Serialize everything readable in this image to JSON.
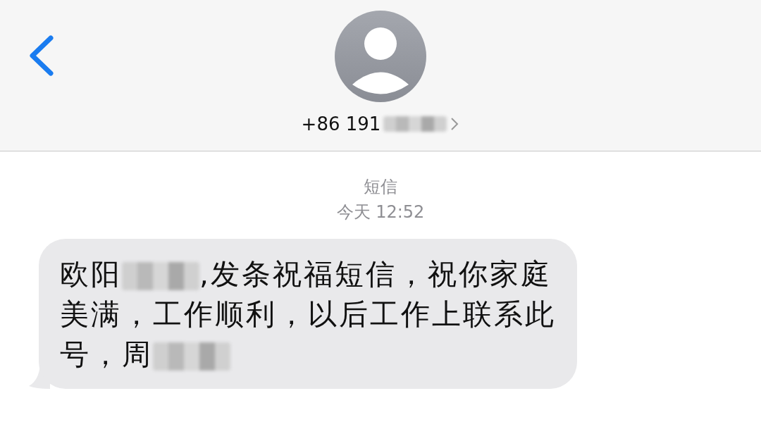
{
  "header": {
    "contact": [
      {
        "kind": "text",
        "text": "+86 191"
      },
      {
        "kind": "redacted"
      }
    ]
  },
  "thread": {
    "service": "短信",
    "timestamp": "今天 12:52"
  },
  "message": {
    "lines": [
      [
        {
          "kind": "text",
          "text": "欧阳"
        },
        {
          "kind": "redacted"
        },
        {
          "kind": "text",
          "text": ",发条祝福短信，祝你家庭"
        }
      ],
      [
        {
          "kind": "text",
          "text": "美满，工作顺利，以后工作上联系此"
        }
      ],
      [
        {
          "kind": "text",
          "text": "号，周"
        },
        {
          "kind": "redacted"
        }
      ]
    ]
  }
}
